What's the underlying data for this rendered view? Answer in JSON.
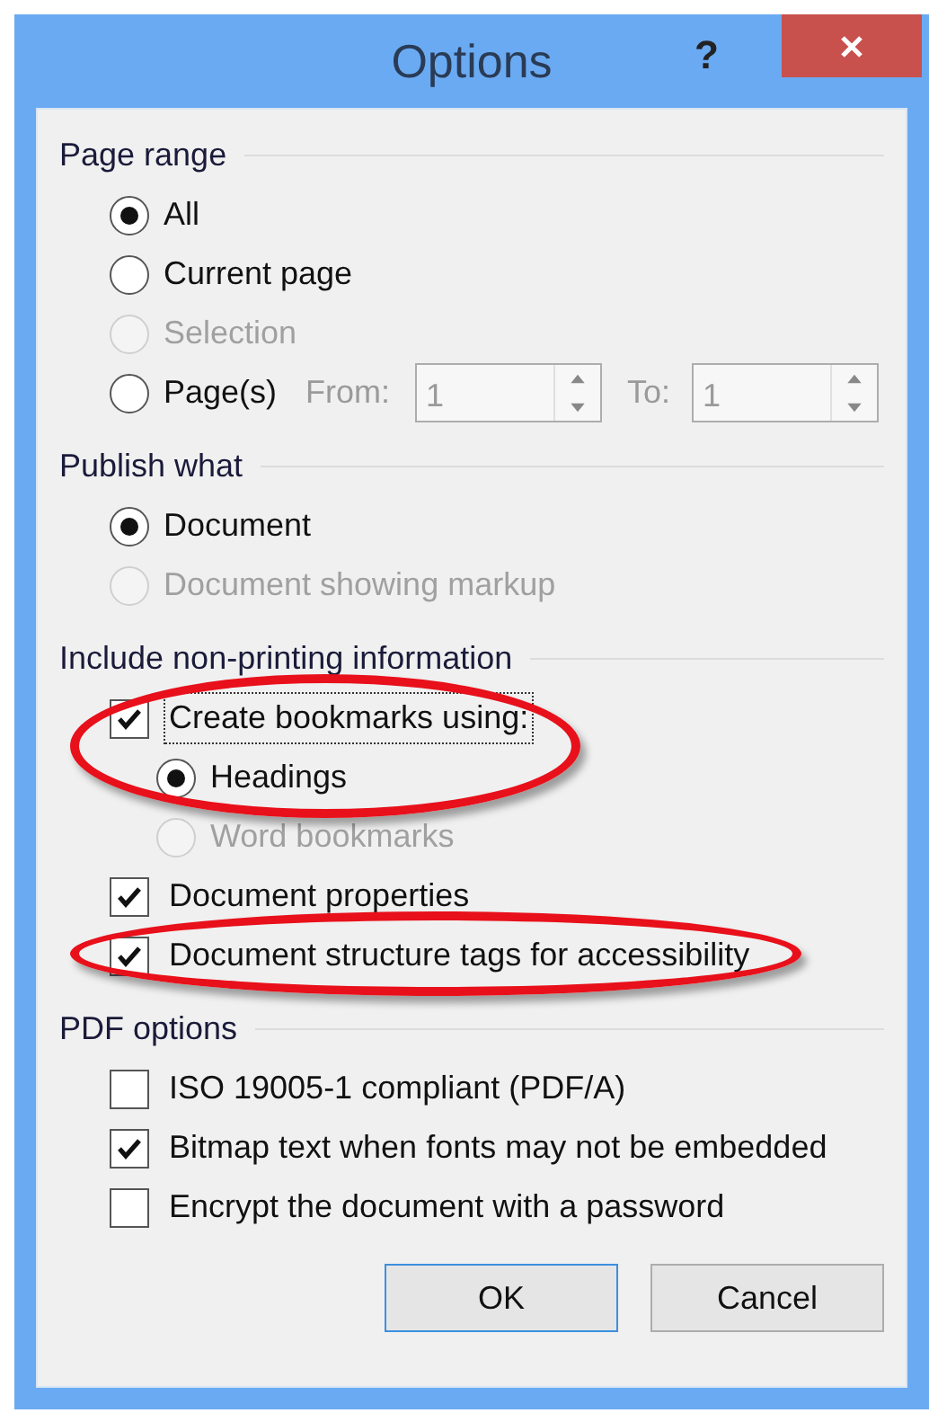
{
  "window": {
    "title": "Options",
    "help": "?"
  },
  "sections": [
    {
      "title": "Page range",
      "items": [
        {
          "kind": "radio",
          "label": "All",
          "selected": true,
          "disabled": false
        },
        {
          "kind": "radio",
          "label": "Current page",
          "selected": false,
          "disabled": false
        },
        {
          "kind": "radio",
          "label": "Selection",
          "selected": false,
          "disabled": true
        },
        {
          "kind": "pages",
          "label": "Page(s)",
          "selected": false,
          "disabled": false,
          "from_label": "From:",
          "from_value": "1",
          "to_label": "To:",
          "to_value": "1"
        }
      ]
    },
    {
      "title": "Publish what",
      "items": [
        {
          "kind": "radio",
          "label": "Document",
          "selected": true,
          "disabled": false
        },
        {
          "kind": "radio",
          "label": "Document showing markup",
          "selected": false,
          "disabled": true
        }
      ]
    },
    {
      "title": "Include non-printing information",
      "items": [
        {
          "kind": "checkbox",
          "label": "Create bookmarks using:",
          "checked": true,
          "disabled": false,
          "focused": true,
          "highlighted": true,
          "children": [
            {
              "kind": "radio",
              "label": "Headings",
              "selected": true,
              "disabled": false,
              "highlighted": true
            },
            {
              "kind": "radio",
              "label": "Word bookmarks",
              "selected": false,
              "disabled": true,
              "highlighted": false
            }
          ]
        },
        {
          "kind": "checkbox",
          "label": "Document properties",
          "checked": true,
          "disabled": false,
          "highlighted": false
        },
        {
          "kind": "checkbox",
          "label": "Document structure tags for accessibility",
          "checked": true,
          "disabled": false,
          "highlighted": true
        }
      ]
    },
    {
      "title": "PDF options",
      "items": [
        {
          "kind": "checkbox",
          "label": "ISO 19005-1 compliant (PDF/A)",
          "checked": false,
          "disabled": false
        },
        {
          "kind": "checkbox",
          "label": "Bitmap text when fonts may not be embedded",
          "checked": true,
          "disabled": false
        },
        {
          "kind": "checkbox",
          "label": "Encrypt the document with a password",
          "checked": false,
          "disabled": false
        }
      ]
    }
  ],
  "buttons": [
    {
      "label": "OK",
      "default": true
    },
    {
      "label": "Cancel",
      "default": false
    }
  ]
}
